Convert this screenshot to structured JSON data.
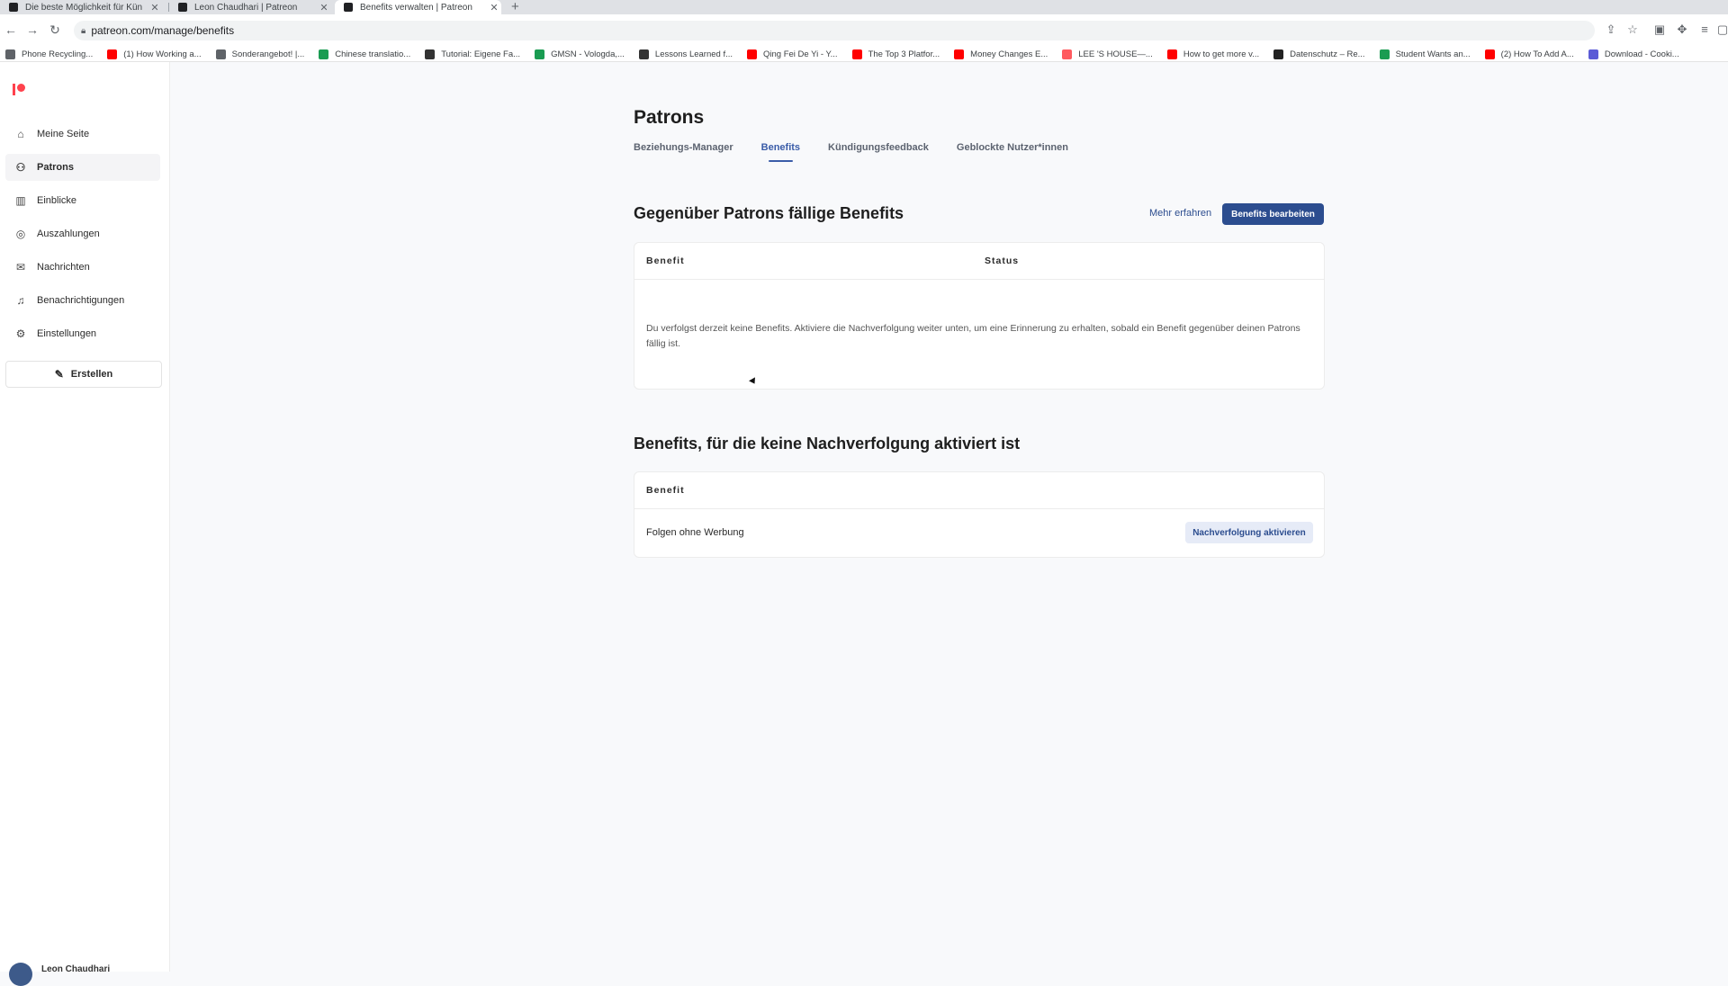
{
  "browser": {
    "tabs": [
      {
        "title": "Die beste Möglichkeit für Kün"
      },
      {
        "title": "Leon Chaudhari | Patreon"
      },
      {
        "title": "Benefits verwalten | Patreon"
      }
    ],
    "url": "patreon.com/manage/benefits",
    "bookmarks": [
      {
        "label": "Phone Recycling...",
        "color": "#5f6368"
      },
      {
        "label": "(1) How Working a...",
        "color": "#ff0000"
      },
      {
        "label": "Sonderangebot! |...",
        "color": "#5f6368"
      },
      {
        "label": "Chinese translatio...",
        "color": "#1a9c52"
      },
      {
        "label": "Tutorial: Eigene Fa...",
        "color": "#333333"
      },
      {
        "label": "GMSN - Vologda,...",
        "color": "#1a9c52"
      },
      {
        "label": "Lessons Learned f...",
        "color": "#333333"
      },
      {
        "label": "Qing Fei De Yi - Y...",
        "color": "#ff0000"
      },
      {
        "label": "The Top 3 Platfor...",
        "color": "#ff0000"
      },
      {
        "label": "Money Changes E...",
        "color": "#ff0000"
      },
      {
        "label": "LEE 'S HOUSE—...",
        "color": "#ff5a5f"
      },
      {
        "label": "How to get more v...",
        "color": "#ff0000"
      },
      {
        "label": "Datenschutz – Re...",
        "color": "#222222"
      },
      {
        "label": "Student Wants an...",
        "color": "#1a9c52"
      },
      {
        "label": "(2) How To Add A...",
        "color": "#ff0000"
      },
      {
        "label": "Download - Cooki...",
        "color": "#5b5bd6"
      }
    ]
  },
  "sidebar": {
    "items": [
      {
        "label": "Meine Seite",
        "icon": "home-icon"
      },
      {
        "label": "Patrons",
        "icon": "people-icon"
      },
      {
        "label": "Einblicke",
        "icon": "chart-icon"
      },
      {
        "label": "Auszahlungen",
        "icon": "payout-icon"
      },
      {
        "label": "Nachrichten",
        "icon": "mail-icon"
      },
      {
        "label": "Benachrichtigungen",
        "icon": "bell-icon"
      },
      {
        "label": "Einstellungen",
        "icon": "gear-icon"
      }
    ],
    "create_label": "Erstellen",
    "user_name": "Leon Chaudhari"
  },
  "main": {
    "title": "Patrons",
    "tabs": [
      {
        "label": "Beziehungs-Manager"
      },
      {
        "label": "Benefits"
      },
      {
        "label": "Kündigungsfeedback"
      },
      {
        "label": "Geblockte Nutzer*innen"
      }
    ],
    "due_section": {
      "title": "Gegenüber Patrons fällige Benefits",
      "more_link": "Mehr erfahren",
      "edit_button": "Benefits bearbeiten",
      "col_benefit": "Benefit",
      "col_status": "Status",
      "empty_message": "Du verfolgst derzeit keine Benefits. Aktiviere die Nachverfolgung weiter unten, um eine Erinnerung zu erhalten, sobald ein Benefit gegenüber deinen Patrons fällig ist."
    },
    "untracked_section": {
      "title": "Benefits, für die keine Nachverfolgung aktiviert ist",
      "col_benefit": "Benefit",
      "rows": [
        {
          "name": "Folgen ohne Werbung",
          "action": "Nachverfolgung aktivieren"
        }
      ]
    }
  },
  "colors": {
    "accent": "#2c4d8f",
    "brand": "#ff424d",
    "page_bg": "#f8f9fb"
  }
}
